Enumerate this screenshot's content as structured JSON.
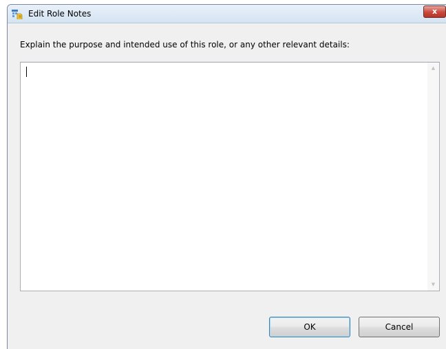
{
  "window": {
    "title": "Edit Role Notes",
    "close_label": "x"
  },
  "dialog": {
    "prompt": "Explain the purpose and intended use of this role, or any other relevant details:",
    "notes_value": "",
    "scroll_up_glyph": "▲",
    "scroll_down_glyph": "▼"
  },
  "buttons": {
    "ok_label": "OK",
    "cancel_label": "Cancel"
  },
  "icons": {
    "app": "role-notes-icon",
    "close": "close-icon"
  },
  "colors": {
    "titlebar": "#d5e3f2",
    "close_button": "#c9493b",
    "dialog_background": "#f0f0f0",
    "default_button_border": "#3c7fb1"
  }
}
